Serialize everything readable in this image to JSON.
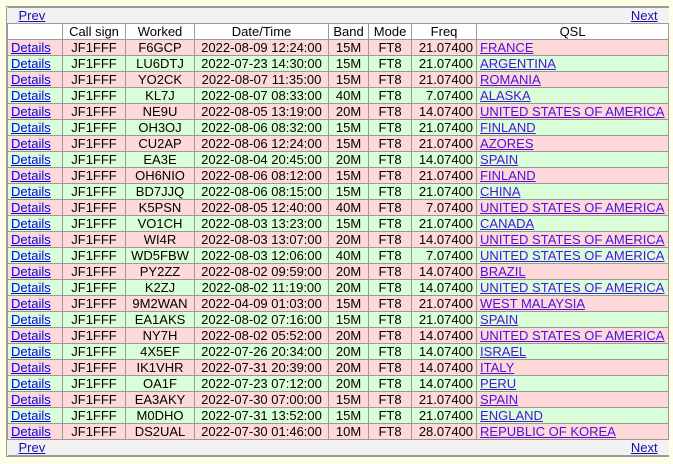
{
  "nav": {
    "prev": "Prev",
    "next": "Next"
  },
  "headers": [
    "",
    "Call sign",
    "Worked",
    "Date/Time",
    "Band",
    "Mode",
    "Freq",
    "QSL"
  ],
  "details_label": "Details",
  "rows": [
    {
      "call": "JF1FFF",
      "worked": "F6GCP",
      "datetime": "2022-08-09 12:24:00",
      "band": "15M",
      "mode": "FT8",
      "freq": "21.07400",
      "qsl": "FRANCE",
      "color": "pink"
    },
    {
      "call": "JF1FFF",
      "worked": "LU6DTJ",
      "datetime": "2022-07-23 14:30:00",
      "band": "15M",
      "mode": "FT8",
      "freq": "21.07400",
      "qsl": "ARGENTINA",
      "color": "green"
    },
    {
      "call": "JF1FFF",
      "worked": "YO2CK",
      "datetime": "2022-08-07 11:35:00",
      "band": "15M",
      "mode": "FT8",
      "freq": "21.07400",
      "qsl": "ROMANIA",
      "color": "pink"
    },
    {
      "call": "JF1FFF",
      "worked": "KL7J",
      "datetime": "2022-08-07 08:33:00",
      "band": "40M",
      "mode": "FT8",
      "freq": "7.07400",
      "qsl": "ALASKA",
      "color": "green"
    },
    {
      "call": "JF1FFF",
      "worked": "NE9U",
      "datetime": "2022-08-05 13:19:00",
      "band": "20M",
      "mode": "FT8",
      "freq": "14.07400",
      "qsl": "UNITED STATES OF AMERICA",
      "color": "pink"
    },
    {
      "call": "JF1FFF",
      "worked": "OH3OJ",
      "datetime": "2022-08-06 08:32:00",
      "band": "15M",
      "mode": "FT8",
      "freq": "21.07400",
      "qsl": "FINLAND",
      "color": "green"
    },
    {
      "call": "JF1FFF",
      "worked": "CU2AP",
      "datetime": "2022-08-06 12:24:00",
      "band": "15M",
      "mode": "FT8",
      "freq": "21.07400",
      "qsl": "AZORES",
      "color": "pink"
    },
    {
      "call": "JF1FFF",
      "worked": "EA3E",
      "datetime": "2022-08-04 20:45:00",
      "band": "20M",
      "mode": "FT8",
      "freq": "14.07400",
      "qsl": "SPAIN",
      "color": "green"
    },
    {
      "call": "JF1FFF",
      "worked": "OH6NIO",
      "datetime": "2022-08-06 08:12:00",
      "band": "15M",
      "mode": "FT8",
      "freq": "21.07400",
      "qsl": "FINLAND",
      "color": "pink"
    },
    {
      "call": "JF1FFF",
      "worked": "BD7JJQ",
      "datetime": "2022-08-06 08:15:00",
      "band": "15M",
      "mode": "FT8",
      "freq": "21.07400",
      "qsl": "CHINA",
      "color": "green"
    },
    {
      "call": "JF1FFF",
      "worked": "K5PSN",
      "datetime": "2022-08-05 12:40:00",
      "band": "40M",
      "mode": "FT8",
      "freq": "7.07400",
      "qsl": "UNITED STATES OF AMERICA",
      "color": "pink"
    },
    {
      "call": "JF1FFF",
      "worked": "VO1CH",
      "datetime": "2022-08-03 13:23:00",
      "band": "15M",
      "mode": "FT8",
      "freq": "21.07400",
      "qsl": "CANADA",
      "color": "green"
    },
    {
      "call": "JF1FFF",
      "worked": "WI4R",
      "datetime": "2022-08-03 13:07:00",
      "band": "20M",
      "mode": "FT8",
      "freq": "14.07400",
      "qsl": "UNITED STATES OF AMERICA",
      "color": "pink"
    },
    {
      "call": "JF1FFF",
      "worked": "WD5FBW",
      "datetime": "2022-08-03 12:06:00",
      "band": "40M",
      "mode": "FT8",
      "freq": "7.07400",
      "qsl": "UNITED STATES OF AMERICA",
      "color": "green"
    },
    {
      "call": "JF1FFF",
      "worked": "PY2ZZ",
      "datetime": "2022-08-02 09:59:00",
      "band": "20M",
      "mode": "FT8",
      "freq": "14.07400",
      "qsl": "BRAZIL",
      "color": "pink"
    },
    {
      "call": "JF1FFF",
      "worked": "K2ZJ",
      "datetime": "2022-08-02 11:19:00",
      "band": "20M",
      "mode": "FT8",
      "freq": "14.07400",
      "qsl": "UNITED STATES OF AMERICA",
      "color": "green"
    },
    {
      "call": "JF1FFF",
      "worked": "9M2WAN",
      "datetime": "2022-04-09 01:03:00",
      "band": "15M",
      "mode": "FT8",
      "freq": "21.07400",
      "qsl": "WEST MALAYSIA",
      "color": "pink"
    },
    {
      "call": "JF1FFF",
      "worked": "EA1AKS",
      "datetime": "2022-08-02 07:16:00",
      "band": "15M",
      "mode": "FT8",
      "freq": "21.07400",
      "qsl": "SPAIN",
      "color": "green"
    },
    {
      "call": "JF1FFF",
      "worked": "NY7H",
      "datetime": "2022-08-02 05:52:00",
      "band": "20M",
      "mode": "FT8",
      "freq": "14.07400",
      "qsl": "UNITED STATES OF AMERICA",
      "color": "pink"
    },
    {
      "call": "JF1FFF",
      "worked": "4X5EF",
      "datetime": "2022-07-26 20:34:00",
      "band": "20M",
      "mode": "FT8",
      "freq": "14.07400",
      "qsl": "ISRAEL",
      "color": "green"
    },
    {
      "call": "JF1FFF",
      "worked": "IK1VHR",
      "datetime": "2022-07-31 20:39:00",
      "band": "20M",
      "mode": "FT8",
      "freq": "14.07400",
      "qsl": "ITALY",
      "color": "pink"
    },
    {
      "call": "JF1FFF",
      "worked": "OA1F",
      "datetime": "2022-07-23 07:12:00",
      "band": "20M",
      "mode": "FT8",
      "freq": "14.07400",
      "qsl": "PERU",
      "color": "green"
    },
    {
      "call": "JF1FFF",
      "worked": "EA3AKY",
      "datetime": "2022-07-30 07:00:00",
      "band": "15M",
      "mode": "FT8",
      "freq": "21.07400",
      "qsl": "SPAIN",
      "color": "pink"
    },
    {
      "call": "JF1FFF",
      "worked": "M0DHO",
      "datetime": "2022-07-31 13:52:00",
      "band": "15M",
      "mode": "FT8",
      "freq": "21.07400",
      "qsl": "ENGLAND",
      "color": "green"
    },
    {
      "call": "JF1FFF",
      "worked": "DS2UAL",
      "datetime": "2022-07-30 01:46:00",
      "band": "10M",
      "mode": "FT8",
      "freq": "28.07400",
      "qsl": "REPUBLIC OF KOREA",
      "color": "pink"
    }
  ],
  "colors": {
    "pink": "#ffd9d9",
    "green": "#d9ffd9",
    "background": "#ffffe8",
    "link": "#0000ee"
  }
}
